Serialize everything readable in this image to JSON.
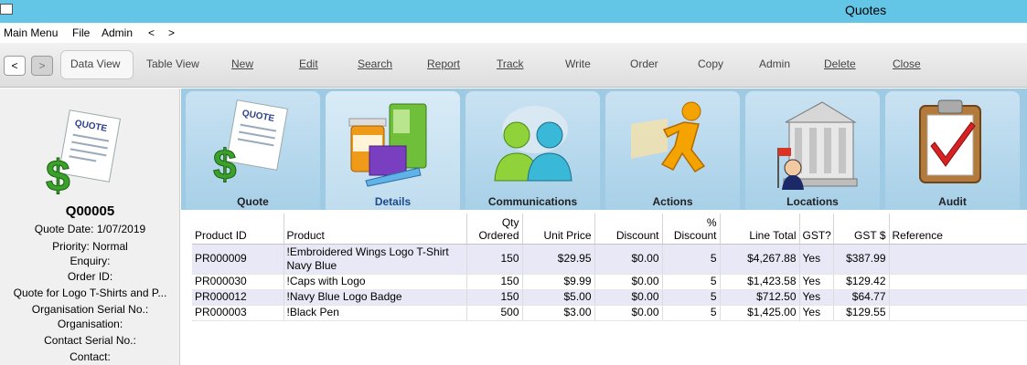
{
  "window": {
    "title": "Quotes"
  },
  "menu": {
    "items": [
      "Main Menu",
      "File",
      "Admin",
      "<",
      ">"
    ]
  },
  "toolbar": {
    "back": "<",
    "forward": ">",
    "buttons": [
      {
        "label": "Data View"
      },
      {
        "label": "Table View"
      },
      {
        "label": "New"
      },
      {
        "label": "Edit"
      },
      {
        "label": "Search"
      },
      {
        "label": "Report"
      },
      {
        "label": "Track"
      },
      {
        "label": "Write"
      },
      {
        "label": "Order"
      },
      {
        "label": "Copy"
      },
      {
        "label": "Admin"
      },
      {
        "label": "Delete"
      },
      {
        "label": "Close"
      }
    ]
  },
  "sidebar": {
    "quote_id": "Q00005",
    "lines": [
      "Quote Date: 1/07/2019",
      "Priority: Normal",
      "Enquiry:",
      "Order ID:",
      "Quote for Logo T-Shirts and P...",
      "Organisation Serial No.:",
      "Organisation:",
      "Contact Serial No.:",
      "Contact:"
    ]
  },
  "tabs": [
    {
      "label": "Quote",
      "icon": "quote-document-icon"
    },
    {
      "label": "Details",
      "icon": "products-icon"
    },
    {
      "label": "Communications",
      "icon": "people-icon"
    },
    {
      "label": "Actions",
      "icon": "running-man-icon"
    },
    {
      "label": "Locations",
      "icon": "building-icon"
    },
    {
      "label": "Audit",
      "icon": "clipboard-check-icon"
    }
  ],
  "grid": {
    "headers": [
      "Product ID",
      "Product",
      "Qty Ordered",
      "Unit Price",
      "Discount",
      "% Discount",
      "Line Total",
      "GST?",
      "GST $",
      "Reference"
    ],
    "rows": [
      {
        "id": "PR000009",
        "product": "!Embroidered Wings Logo T-Shirt Navy Blue",
        "qty": "150",
        "price": "$29.95",
        "discount": "$0.00",
        "pct": "5",
        "total": "$4,267.88",
        "gst": "Yes",
        "gst_amt": "$387.99",
        "ref": ""
      },
      {
        "id": "PR000030",
        "product": "!Caps with Logo",
        "qty": "150",
        "price": "$9.99",
        "discount": "$0.00",
        "pct": "5",
        "total": "$1,423.58",
        "gst": "Yes",
        "gst_amt": "$129.42",
        "ref": ""
      },
      {
        "id": "PR000012",
        "product": "!Navy Blue Logo Badge",
        "qty": "150",
        "price": "$5.00",
        "discount": "$0.00",
        "pct": "5",
        "total": "$712.50",
        "gst": "Yes",
        "gst_amt": "$64.77",
        "ref": ""
      },
      {
        "id": "PR000003",
        "product": "!Black Pen",
        "qty": "500",
        "price": "$3.00",
        "discount": "$0.00",
        "pct": "5",
        "total": "$1,425.00",
        "gst": "Yes",
        "gst_amt": "$129.55",
        "ref": ""
      }
    ]
  },
  "colors": {
    "titlebar": "#63c6e6",
    "tabstrip": "#9ecbe3",
    "row_alt": "#e8e8f6"
  }
}
